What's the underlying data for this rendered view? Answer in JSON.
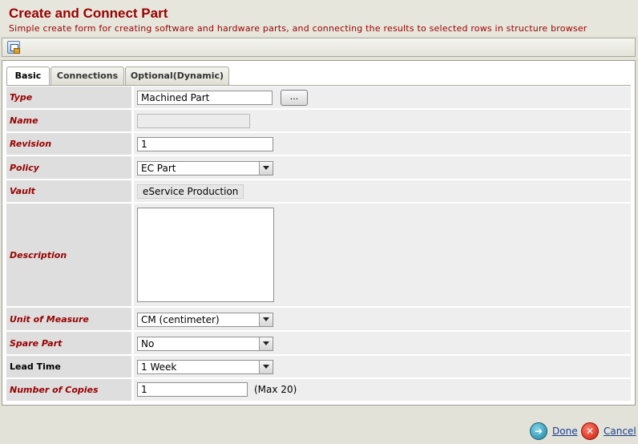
{
  "header": {
    "title": "Create and Connect Part",
    "subtitle": "Simple create form for creating software and hardware parts, and connecting the results to selected rows in structure browser"
  },
  "toolbar": {
    "icon": "form-action-icon"
  },
  "tabs": [
    {
      "label": "Basic",
      "active": true
    },
    {
      "label": "Connections",
      "active": false
    },
    {
      "label": "Optional(Dynamic)",
      "active": false
    }
  ],
  "form": {
    "type": {
      "label": "Type",
      "value": "Machined Part",
      "chooser_label": "..."
    },
    "name": {
      "label": "Name",
      "value": ""
    },
    "revision": {
      "label": "Revision",
      "value": "1"
    },
    "policy": {
      "label": "Policy",
      "value": "EC Part"
    },
    "vault": {
      "label": "Vault",
      "value": "eService Production"
    },
    "description": {
      "label": "Description",
      "value": ""
    },
    "unit_of_measure": {
      "label": "Unit of Measure",
      "value": "CM (centimeter)"
    },
    "spare_part": {
      "label": "Spare Part",
      "value": "No"
    },
    "lead_time": {
      "label": "Lead Time",
      "value": "1 Week"
    },
    "copies": {
      "label": "Number of Copies",
      "value": "1",
      "hint": "(Max 20)"
    }
  },
  "footer": {
    "done_label": "Done",
    "cancel_label": "Cancel"
  },
  "colors": {
    "label_red": "#990000",
    "link_blue": "#1a3c8c"
  }
}
